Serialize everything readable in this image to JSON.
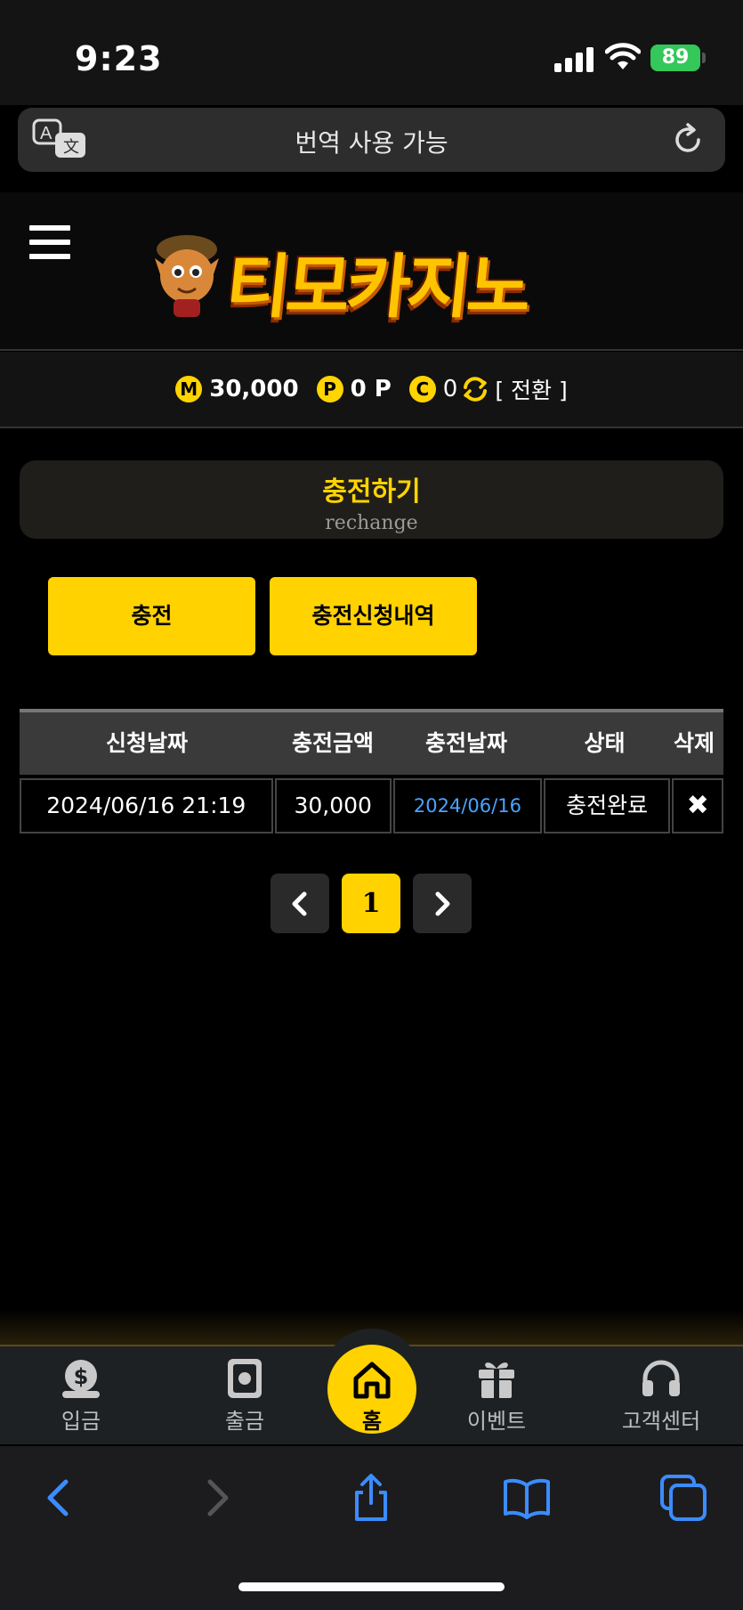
{
  "status_bar": {
    "time": "9:23",
    "battery": "89"
  },
  "translate_bar": {
    "text": "번역 사용 가능"
  },
  "header": {
    "logo_text": "티모카지노"
  },
  "balance": {
    "money_icon": "M",
    "money": "30,000",
    "point_icon": "P",
    "point": "0 P",
    "casino_icon": "C",
    "casino": "0",
    "switch_label": "[ 전환 ]"
  },
  "page": {
    "title": "충전하기",
    "subtitle": "rechange"
  },
  "buttons": {
    "charge": "충전",
    "history": "충전신청내역"
  },
  "table": {
    "headers": [
      "신청날짜",
      "충전금액",
      "충전날짜",
      "상태",
      "삭제"
    ],
    "rows": [
      {
        "request_date": "2024/06/16 21:19",
        "amount": "30,000",
        "charge_date": "2024/06/16",
        "status": "충전완료",
        "delete": "✖"
      }
    ]
  },
  "pagination": {
    "current": "1"
  },
  "bottom_nav": {
    "deposit": "입금",
    "withdraw": "출금",
    "home": "홈",
    "event": "이벤트",
    "support": "고객센터"
  },
  "colors": {
    "accent": "#ffd200",
    "link": "#4aa3ff",
    "battery": "#34c759"
  },
  "icons": [
    "translate-icon",
    "reload-icon",
    "menu-icon",
    "swap-icon",
    "chevron-left-icon",
    "chevron-right-icon",
    "money-bag-icon",
    "safe-icon",
    "house-icon",
    "gift-icon",
    "headset-icon",
    "back-icon",
    "forward-icon",
    "share-icon",
    "bookmarks-icon",
    "tabs-icon"
  ]
}
